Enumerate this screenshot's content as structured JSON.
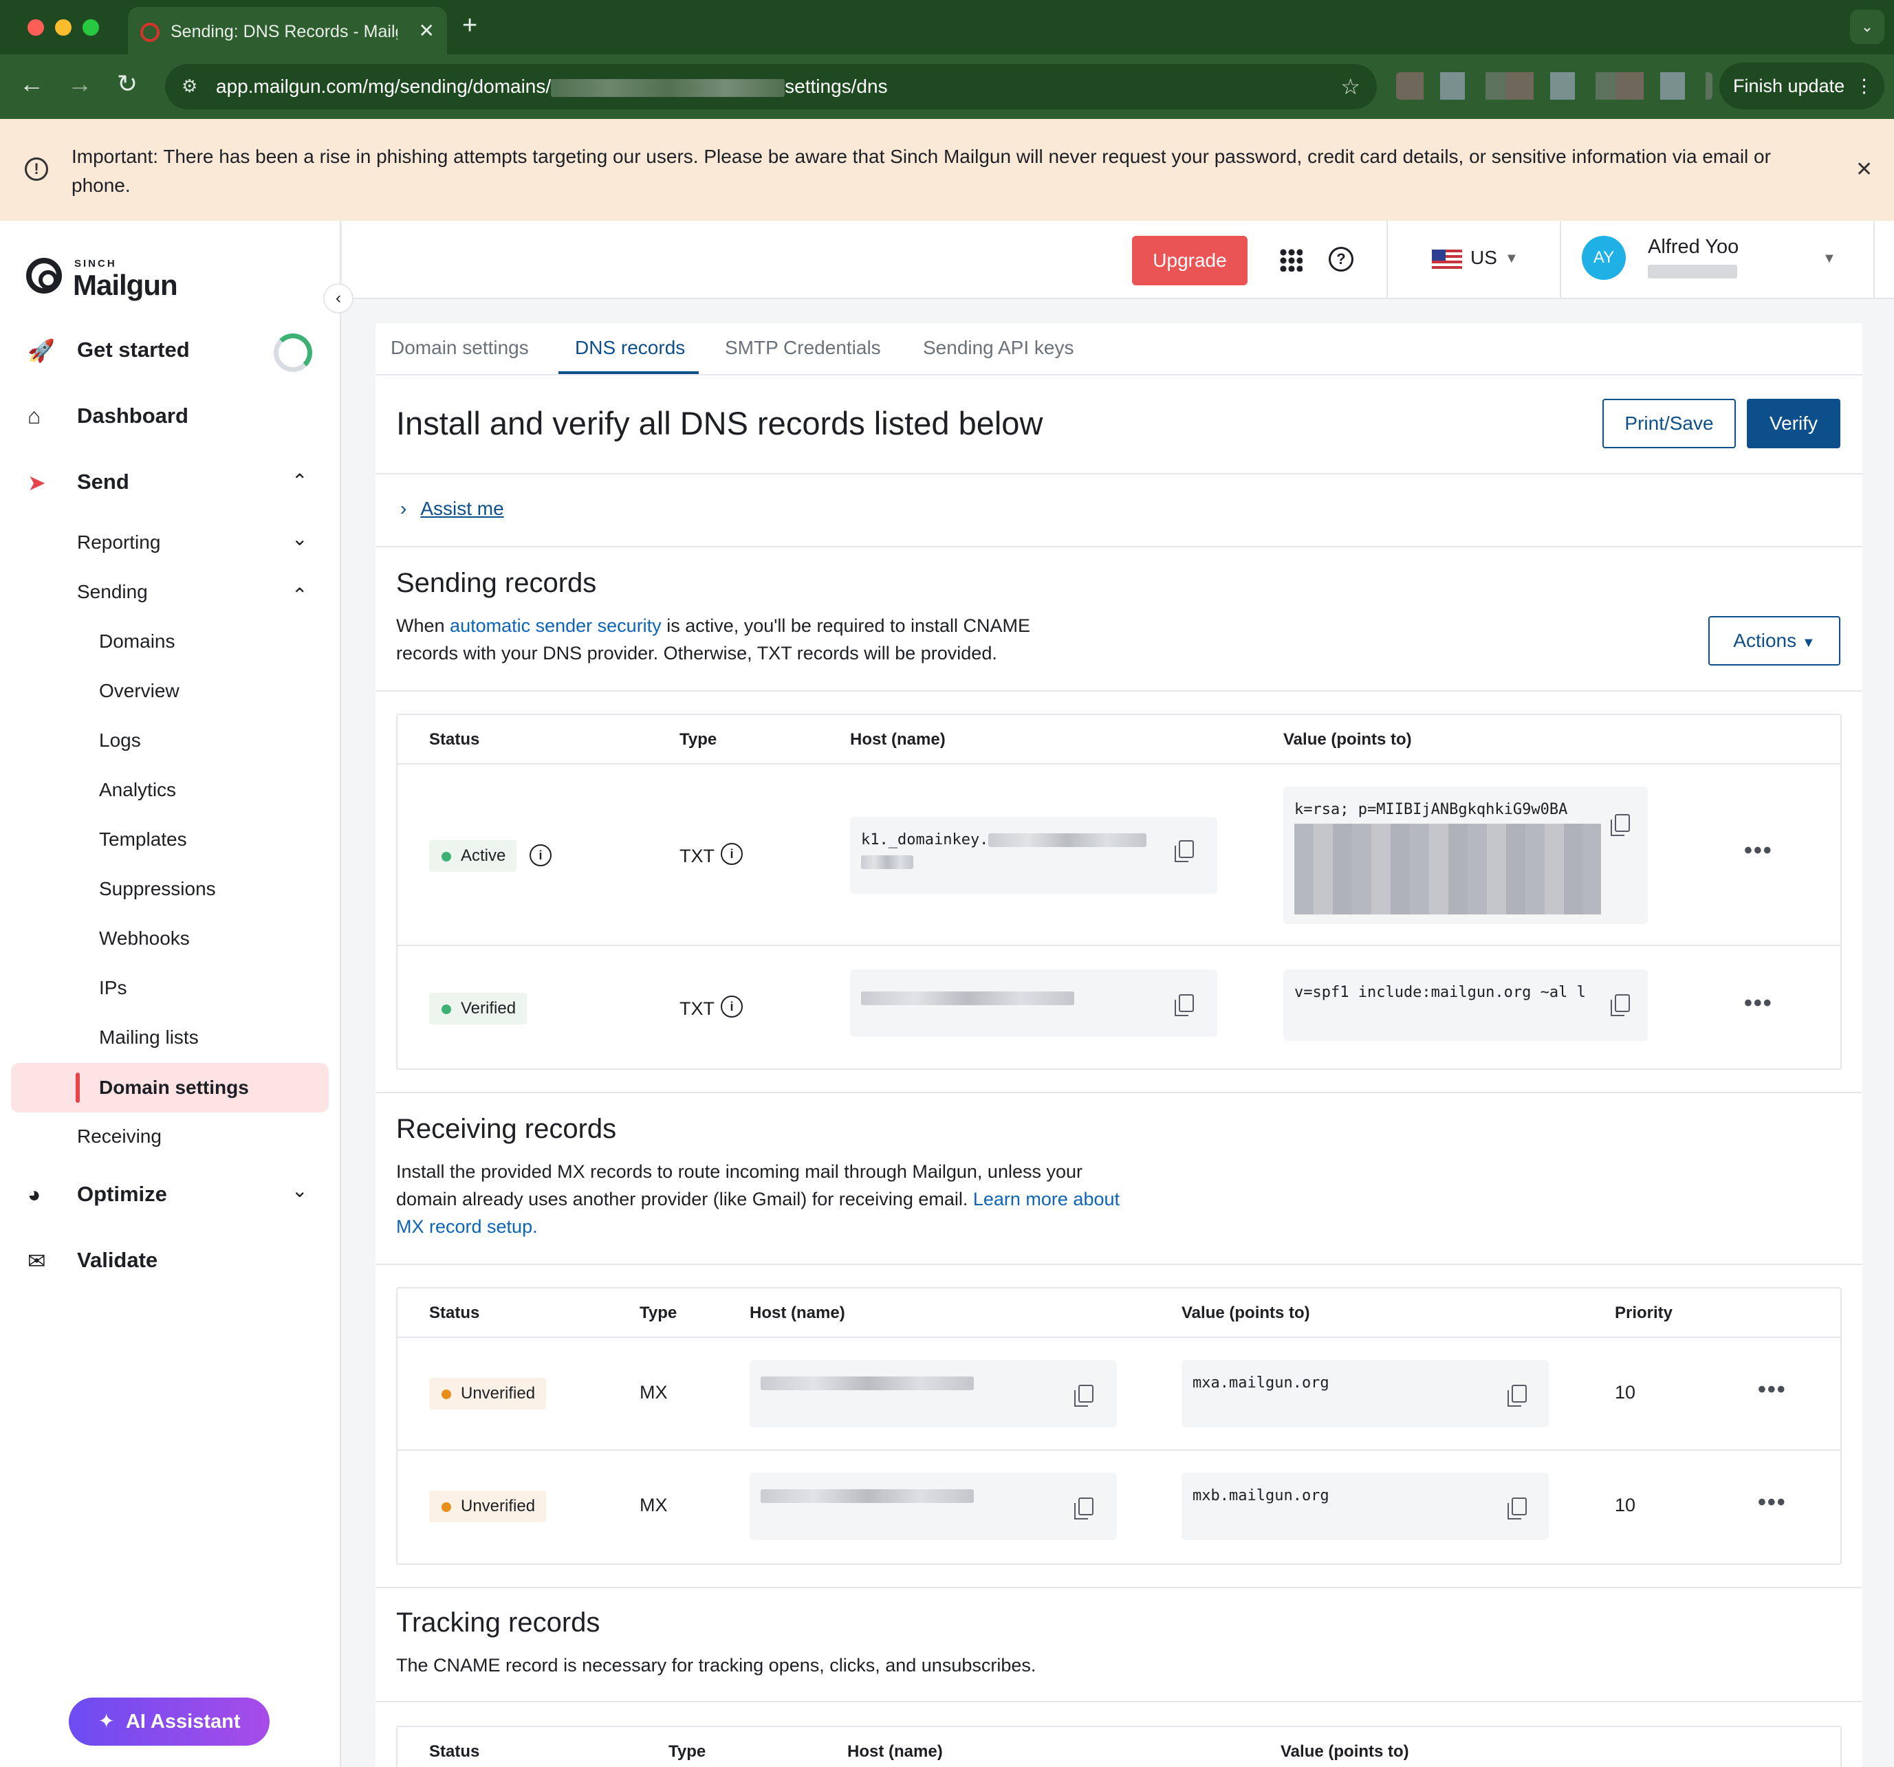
{
  "browser": {
    "tab_title": "Sending: DNS Records - Mailgun",
    "url_prefix": "app.mailgun.com/mg/sending/domains/",
    "url_suffix": "settings/dns",
    "finish_update": "Finish update"
  },
  "banner": {
    "text": "Important: There has been a rise in phishing attempts targeting our users. Please be aware that Sinch Mailgun will never request your password, credit card details, or sensitive information via email or phone."
  },
  "logo": {
    "brand_top": "SINCH",
    "brand_name": "Mailgun"
  },
  "sidebar": {
    "get_started": "Get started",
    "dashboard": "Dashboard",
    "send": "Send",
    "reporting": "Reporting",
    "sending": "Sending",
    "sending_items": [
      "Domains",
      "Overview",
      "Logs",
      "Analytics",
      "Templates",
      "Suppressions",
      "Webhooks",
      "IPs",
      "Mailing lists",
      "Domain settings"
    ],
    "receiving": "Receiving",
    "optimize": "Optimize",
    "validate": "Validate",
    "ai_assistant": "AI Assistant"
  },
  "header": {
    "upgrade": "Upgrade",
    "region": "US",
    "avatar_initials": "AY",
    "user_name": "Alfred Yoo"
  },
  "tabs": [
    "Domain settings",
    "DNS records",
    "SMTP Credentials",
    "Sending API keys"
  ],
  "page": {
    "title": "Install and verify all DNS records listed below",
    "print_save": "Print/Save",
    "verify": "Verify",
    "assist": "Assist me"
  },
  "sending_records": {
    "title": "Sending records",
    "desc_pre": "When ",
    "desc_link": "automatic sender security",
    "desc_post": " is active, you'll be required to install CNAME records with your DNS provider. Otherwise, TXT records will be provided.",
    "actions": "Actions",
    "columns": [
      "Status",
      "Type",
      "Host (name)",
      "Value (points to)"
    ],
    "rows": [
      {
        "status": "Active",
        "type": "TXT",
        "host": "k1._domainkey.",
        "value": "k=rsa; p=MIIBIjANBgkqhkiG9w0BA"
      },
      {
        "status": "Verified",
        "type": "TXT",
        "host": "",
        "value": "v=spf1 include:mailgun.org ~al l"
      }
    ]
  },
  "receiving_records": {
    "title": "Receiving records",
    "desc_pre": "Install the provided MX records to route incoming mail through Mailgun, unless your domain already uses another provider (like Gmail) for receiving email. ",
    "desc_link": "Learn more about MX record setup.",
    "columns": [
      "Status",
      "Type",
      "Host (name)",
      "Value (points to)",
      "Priority"
    ],
    "rows": [
      {
        "status": "Unverified",
        "type": "MX",
        "value": "mxa.mailgun.org",
        "priority": "10"
      },
      {
        "status": "Unverified",
        "type": "MX",
        "value": "mxb.mailgun.org",
        "priority": "10"
      }
    ]
  },
  "tracking_records": {
    "title": "Tracking records",
    "desc": "The CNAME record is necessary for tracking opens, clicks, and unsubscribes.",
    "columns": [
      "Status",
      "Type",
      "Host (name)",
      "Value (points to)"
    ]
  },
  "colors": {
    "accent": "#0d4f8b",
    "upgrade": "#ea5455",
    "status_green": "#3bb273",
    "status_orange": "#e88f1a",
    "banner_bg": "#fbe9d8",
    "chrome_green": "#2e5e2f"
  }
}
